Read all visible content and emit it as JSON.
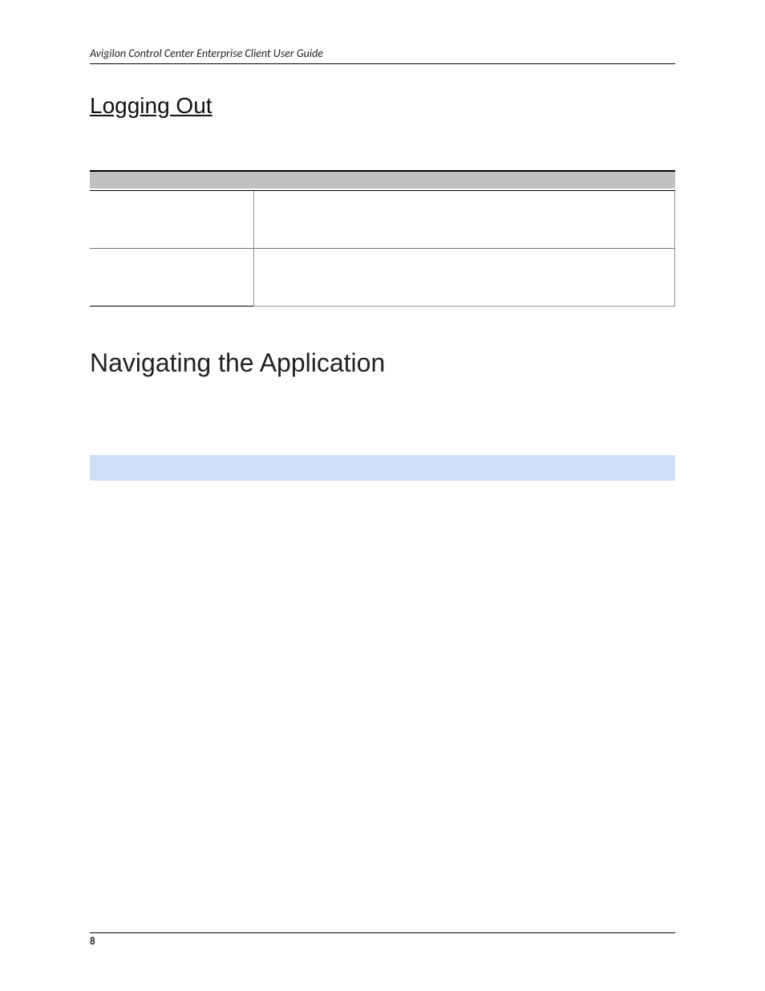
{
  "header": {
    "title": "Avigilon Control Center Enterprise Client User Guide"
  },
  "sections": {
    "logging_out_title": "Logging Out",
    "navigating_title": "Navigating the Application"
  },
  "table": {
    "headers": [
      "",
      ""
    ],
    "rows": [
      {
        "col1": "",
        "col2": ""
      },
      {
        "col1": "",
        "col2": ""
      }
    ]
  },
  "footer": {
    "page_number": "8"
  }
}
